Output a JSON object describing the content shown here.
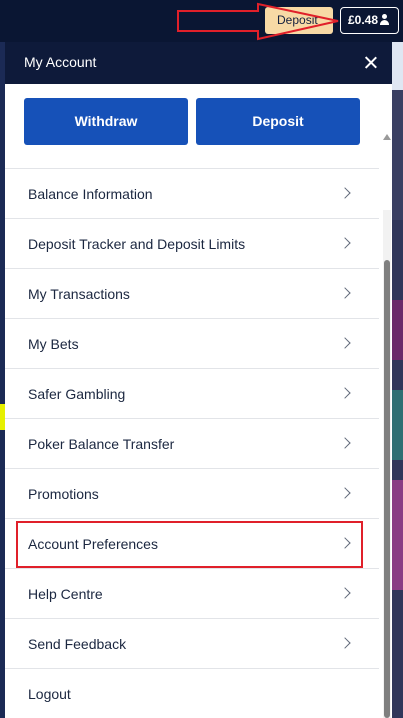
{
  "header": {
    "deposit_label": "Deposit",
    "balance": "£0.48",
    "user_icon": "user-icon"
  },
  "modal": {
    "title": "My Account",
    "close_icon": "close-icon",
    "withdraw_label": "Withdraw",
    "deposit_label": "Deposit",
    "items": [
      {
        "label": "Balance Information"
      },
      {
        "label": "Deposit Tracker and Deposit Limits"
      },
      {
        "label": "My Transactions"
      },
      {
        "label": "My Bets"
      },
      {
        "label": "Safer Gambling"
      },
      {
        "label": "Poker Balance Transfer"
      },
      {
        "label": "Promotions"
      },
      {
        "label": "Account Preferences"
      },
      {
        "label": "Help Centre"
      },
      {
        "label": "Send Feedback"
      },
      {
        "label": "Logout"
      }
    ]
  },
  "colors": {
    "brand_navy": "#0e1a3a",
    "button_blue": "#1651b8",
    "deposit_pill": "#f7d9a5",
    "highlight_red": "#e0202a"
  }
}
